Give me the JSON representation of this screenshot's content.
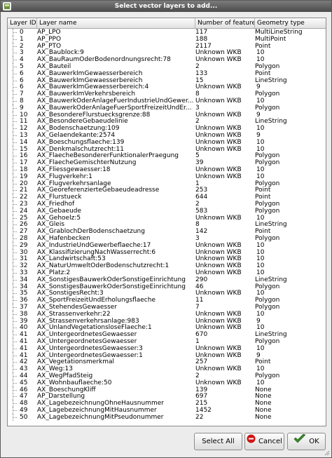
{
  "window": {
    "title": "Select vector layers to add..."
  },
  "table": {
    "headers": [
      "Layer ID",
      "Layer name",
      "Number of features",
      "Geometry type"
    ],
    "rows": [
      [
        "0",
        "AP_LPO",
        "117",
        "MultiLineString"
      ],
      [
        "1",
        "AP_PPO",
        "188",
        "MultiPoint"
      ],
      [
        "2",
        "AP_PTO",
        "2117",
        "Point"
      ],
      [
        "3",
        "AX_Baublock:9",
        "Unknown WKB",
        "10"
      ],
      [
        "4",
        "AX_BauRaumOderBodenordnungsrecht:78",
        "Unknown WKB",
        "10"
      ],
      [
        "5",
        "AX_Bauteil",
        "2",
        "Polygon"
      ],
      [
        "6",
        "AX_BauwerkImGewaesserbereich",
        "133",
        "Point"
      ],
      [
        "6",
        "AX_BauwerkImGewaesserbereich",
        "15",
        "LineString"
      ],
      [
        "6",
        "AX_BauwerkImGewaesserbereich:4",
        "Unknown WKB",
        "9"
      ],
      [
        "7",
        "AX_BauwerkImVerkehrsbereich",
        "8",
        "Polygon"
      ],
      [
        "8",
        "AX_BauwerkOderAnlageFuerIndustrieUndGewer...",
        "Unknown WKB",
        "10"
      ],
      [
        "9",
        "AX_BauwerkOderAnlageFuerSportFreizeitUndEr...",
        "3",
        "Polygon"
      ],
      [
        "10",
        "AX_BesondereFlurstuecksgrenze:88",
        "Unknown WKB",
        "9"
      ],
      [
        "11",
        "AX_BesondereGebaeudelinie",
        "2",
        "LineString"
      ],
      [
        "12",
        "AX_Bodenschaetzung:109",
        "Unknown WKB",
        "10"
      ],
      [
        "13",
        "AX_Gelaendekante:2574",
        "Unknown WKB",
        "9"
      ],
      [
        "14",
        "AX_Boeschungsflaeche:139",
        "Unknown WKB",
        "10"
      ],
      [
        "15",
        "AX_Denkmalschutzrecht:11",
        "Unknown WKB",
        "10"
      ],
      [
        "16",
        "AX_FlaecheBesondererFunktionalerPraegung",
        "5",
        "Polygon"
      ],
      [
        "17",
        "AX_FlaecheGemischterNutzung",
        "39",
        "Polygon"
      ],
      [
        "18",
        "AX_Fliessgewaesser:18",
        "Unknown WKB",
        "10"
      ],
      [
        "19",
        "AX_Flugverkehr:1",
        "Unknown WKB",
        "10"
      ],
      [
        "20",
        "AX_Flugverkehrsanlage",
        "1",
        "Polygon"
      ],
      [
        "21",
        "AX_GeoreferenzierteGebaeudeadresse",
        "253",
        "Point"
      ],
      [
        "22",
        "AX_Flurstueck",
        "644",
        "Point"
      ],
      [
        "23",
        "AX_Friedhof",
        "2",
        "Polygon"
      ],
      [
        "24",
        "AX_Gebaeude",
        "583",
        "Polygon"
      ],
      [
        "25",
        "AX_Gehoelz:5",
        "Unknown WKB",
        "10"
      ],
      [
        "26",
        "AX_Gleis",
        "8",
        "LineString"
      ],
      [
        "27",
        "AX_GrablochDerBodenschaetzung",
        "142",
        "Point"
      ],
      [
        "28",
        "AX_Hafenbecken",
        "3",
        "Polygon"
      ],
      [
        "29",
        "AX_IndustrieUndGewerbeflaeche:17",
        "Unknown WKB",
        "10"
      ],
      [
        "30",
        "AX_KlassifizierungNachWasserrecht:6",
        "Unknown WKB",
        "10"
      ],
      [
        "31",
        "AX_Landwirtschaft:53",
        "Unknown WKB",
        "10"
      ],
      [
        "32",
        "AX_NaturUmweltOderBodenschutzrecht:1",
        "Unknown WKB",
        "10"
      ],
      [
        "33",
        "AX_Platz:2",
        "Unknown WKB",
        "10"
      ],
      [
        "34",
        "AX_SonstigesBauwerkOderSonstigeEinrichtung",
        "290",
        "LineString"
      ],
      [
        "34",
        "AX_SonstigesBauwerkOderSonstigeEinrichtung",
        "46",
        "Polygon"
      ],
      [
        "35",
        "AX_SonstigesRecht:3",
        "Unknown WKB",
        "10"
      ],
      [
        "36",
        "AX_SportFreizeitUndErholungsflaeche",
        "11",
        "Polygon"
      ],
      [
        "37",
        "AX_StehendesGewaesser",
        "7",
        "Polygon"
      ],
      [
        "38",
        "AX_Strassenverkehr:22",
        "Unknown WKB",
        "10"
      ],
      [
        "39",
        "AX_Strassenverkehrsanlage:983",
        "Unknown WKB",
        "9"
      ],
      [
        "40",
        "AX_UnlandVegetationsloseFlaeche:1",
        "Unknown WKB",
        "10"
      ],
      [
        "41",
        "AX_UntergeordnetesGewaesser",
        "670",
        "LineString"
      ],
      [
        "41",
        "AX_UntergeordnetesGewaesser",
        "1",
        "Polygon"
      ],
      [
        "41",
        "AX_UntergeordnetesGewaesser:3",
        "Unknown WKB",
        "10"
      ],
      [
        "41",
        "AX_UntergeordnetesGewaesser:1",
        "Unknown WKB",
        "9"
      ],
      [
        "42",
        "AX_Vegetationsmerkmal",
        "257",
        "Point"
      ],
      [
        "43",
        "AX_Weg:13",
        "Unknown WKB",
        "10"
      ],
      [
        "44",
        "AX_WegPfadSteig",
        "2",
        "Polygon"
      ],
      [
        "45",
        "AX_Wohnbauflaeche:50",
        "Unknown WKB",
        "10"
      ],
      [
        "46",
        "AX_BoeschungKliff",
        "139",
        "None"
      ],
      [
        "47",
        "AP_Darstellung",
        "697",
        "None"
      ],
      [
        "48",
        "AX_LagebezeichnungOhneHausnummer",
        "215",
        "None"
      ],
      [
        "49",
        "AX_LagebezeichnungMitHausnummer",
        "1452",
        "None"
      ],
      [
        "50",
        "AX_LagebezeichnungMitPseudonummer",
        "22",
        "None"
      ]
    ]
  },
  "buttons": {
    "select_all": "Select All",
    "cancel": "Cancel",
    "ok": "OK"
  },
  "icons": {
    "title": "app-icon",
    "cancel": "cancel-icon",
    "ok": "ok-check-icon"
  },
  "colors": {
    "cancel_red": "#d01414",
    "ok_green": "#3a8a2a",
    "title_bar": "#5a5a5a"
  }
}
